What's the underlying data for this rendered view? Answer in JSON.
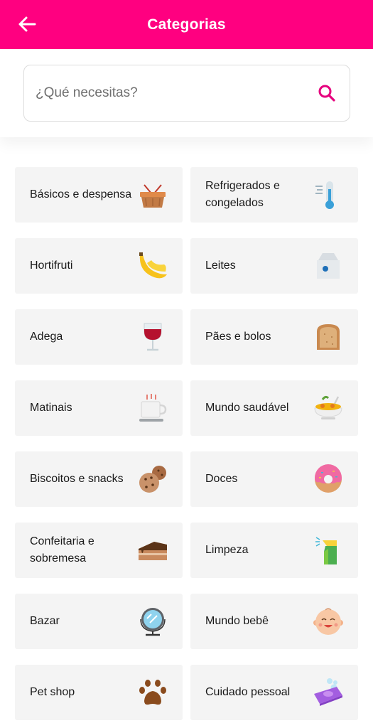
{
  "header": {
    "title": "Categorias",
    "background": "#ff0080",
    "back_icon": "arrow-left-icon"
  },
  "search": {
    "placeholder": "¿Qué necesitas?",
    "value": "",
    "icon": "search-icon",
    "icon_color": "#e6007e"
  },
  "categories": [
    {
      "label": "Básicos e despensa",
      "icon": "picnic-basket-icon"
    },
    {
      "label": "Refrigerados e congelados",
      "icon": "thermometer-cold-icon"
    },
    {
      "label": "Hortifruti",
      "icon": "banana-icon"
    },
    {
      "label": "Leites",
      "icon": "milk-carton-icon"
    },
    {
      "label": "Adega",
      "icon": "wine-glass-icon"
    },
    {
      "label": "Pães e bolos",
      "icon": "bread-slice-icon"
    },
    {
      "label": "Matinais",
      "icon": "coffee-cup-icon"
    },
    {
      "label": "Mundo saudável",
      "icon": "healthy-bowl-icon"
    },
    {
      "label": "Biscoitos e snacks",
      "icon": "cookies-icon"
    },
    {
      "label": "Doces",
      "icon": "donut-icon"
    },
    {
      "label": "Confeitaria e sobremesa",
      "icon": "cake-slice-icon"
    },
    {
      "label": "Limpeza",
      "icon": "spray-bottle-icon"
    },
    {
      "label": "Bazar",
      "icon": "mirror-icon"
    },
    {
      "label": "Mundo bebê",
      "icon": "baby-face-icon"
    },
    {
      "label": "Pet shop",
      "icon": "paw-icon"
    },
    {
      "label": "Cuidado pessoal",
      "icon": "soap-icon"
    }
  ]
}
